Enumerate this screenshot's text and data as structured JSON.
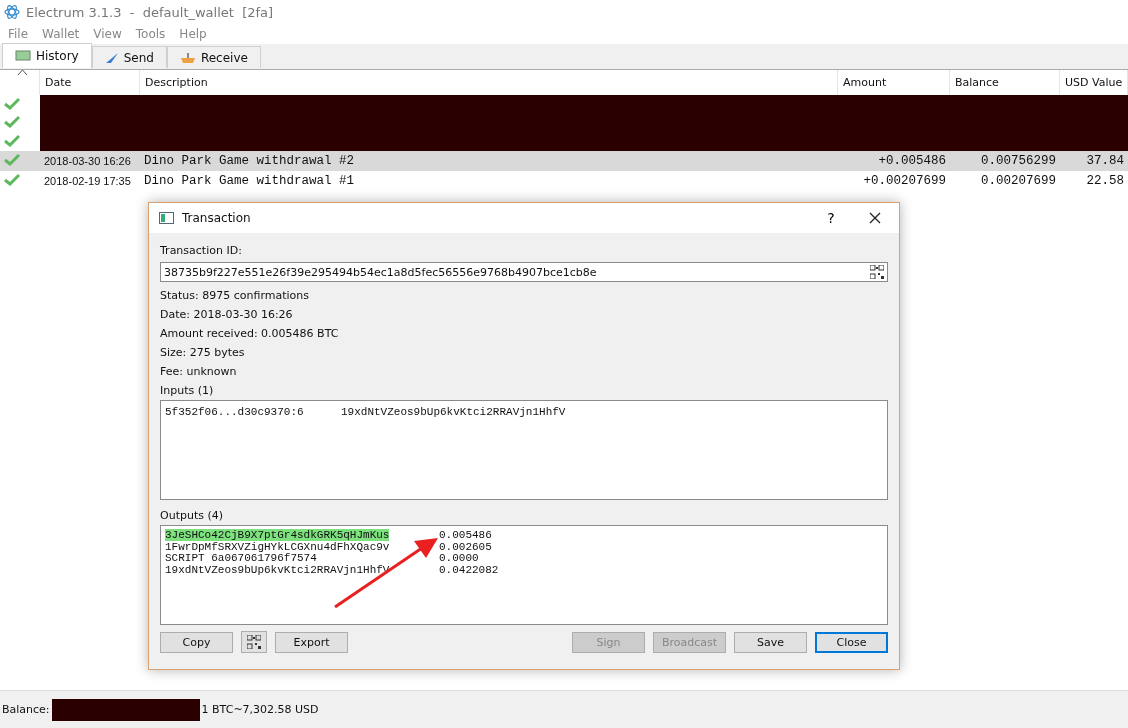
{
  "window": {
    "title": "Electrum 3.1.3  -  default_wallet  [2fa]"
  },
  "menu": [
    "File",
    "Wallet",
    "View",
    "Tools",
    "Help"
  ],
  "tabs": [
    {
      "label": "History",
      "selected": true
    },
    {
      "label": "Send",
      "selected": false
    },
    {
      "label": "Receive",
      "selected": false
    }
  ],
  "history": {
    "columns": [
      "Date",
      "Description",
      "Amount",
      "Balance",
      "USD Value"
    ],
    "rows": [
      {
        "kind": "redacted"
      },
      {
        "kind": "redacted"
      },
      {
        "kind": "redacted"
      },
      {
        "kind": "tx",
        "selected": true,
        "date": "2018-03-30 16:26",
        "description": "Dino Park Game withdrawal #2",
        "amount": "+0.005486",
        "balance": "0.00756299",
        "usd": "37.84"
      },
      {
        "kind": "tx",
        "selected": false,
        "date": "2018-02-19 17:35",
        "description": "Dino Park Game withdrawal #1",
        "amount": "+0.00207699",
        "balance": "0.00207699",
        "usd": "22.58"
      }
    ]
  },
  "dialog": {
    "title": "Transaction",
    "help": "?",
    "txid_label": "Transaction ID:",
    "txid": "38735b9f227e551e26f39e295494b54ec1a8d5fec56556e9768b4907bce1cb8e",
    "details": [
      "Status: 8975 confirmations",
      "Date: 2018-03-30 16:26",
      "Amount received: 0.005486 BTC",
      "Size: 275 bytes",
      "Fee: unknown"
    ],
    "inputs_label": "Inputs (1)",
    "inputs": [
      {
        "prevout": "5f352f06...d30c9370:6",
        "address": "19xdNtVZeos9bUp6kvKtci2RRAVjn1HhfV"
      }
    ],
    "outputs_label": "Outputs (4)",
    "outputs": [
      {
        "address": "3JeSHCo42CjB9X7ptGr4sdkGRK5qHJmKus",
        "amount": "0.005486",
        "highlighted": true
      },
      {
        "address": "1FwrDpMfSRXVZigHYkLCGXnu4dFhXQac9v",
        "amount": "0.002605",
        "highlighted": false
      },
      {
        "address": "SCRIPT 6a067061796f7574",
        "amount": "0.0000",
        "highlighted": false
      },
      {
        "address": "19xdNtVZeos9bUp6kvKtci2RRAVjn1HhfV",
        "amount": "0.0422082",
        "highlighted": false
      }
    ],
    "buttons": [
      {
        "label": "Copy",
        "disabled": false,
        "default": false
      },
      {
        "label": "Export",
        "disabled": false,
        "default": false
      }
    ],
    "right_buttons": [
      {
        "label": "Sign",
        "disabled": true,
        "default": false
      },
      {
        "label": "Broadcast",
        "disabled": true,
        "default": false
      },
      {
        "label": "Save",
        "disabled": false,
        "default": false
      },
      {
        "label": "Close",
        "disabled": false,
        "default": true
      }
    ]
  },
  "status_bar": {
    "balance_label": "Balance:",
    "rate": "1 BTC~7,302.58 USD"
  }
}
